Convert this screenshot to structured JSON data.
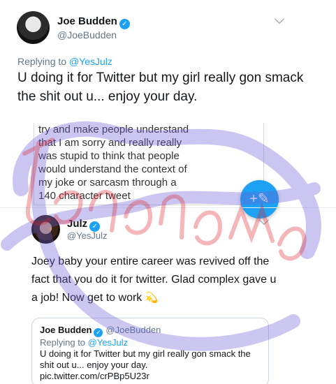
{
  "top_tweet": {
    "name": "Joe Budden",
    "handle": "@JoeBudden",
    "replying_prefix": "Replying to ",
    "replying_handle": "@YesJulz",
    "text": "U doing it for Twitter but my girl really gon smack the shit out u... enjoy your day."
  },
  "screenshot_card": {
    "lines": [
      "try and make people understand",
      "that I am sorry and really really",
      "was stupid to think that people",
      "would understand the context of",
      "my joke or sarcasm through a",
      "140 character tweet"
    ],
    "fab_icon": "compose-feather-icon"
  },
  "reply_tweet": {
    "name": "Julz",
    "handle": "@YesJulz",
    "text": "Joey baby your entire career was revived off the fact that you do it for twitter. Glad complex gave u a job! Now get to work",
    "emoji": "💫"
  },
  "quoted_tweet": {
    "name": "Joe Budden",
    "handle": "@JoeBudden",
    "replying_prefix": "Replying to ",
    "replying_handle": "@YesJulz",
    "text": "U doing it for Twitter but my girl really gon smack the shit out u... enjoy your day.",
    "link": "pic.twitter.com/crPBp5U23r"
  },
  "colors": {
    "twitter_blue": "#1da1f2",
    "watermark_red": "#e0202a",
    "watermark_purple": "#6a5fd8"
  }
}
